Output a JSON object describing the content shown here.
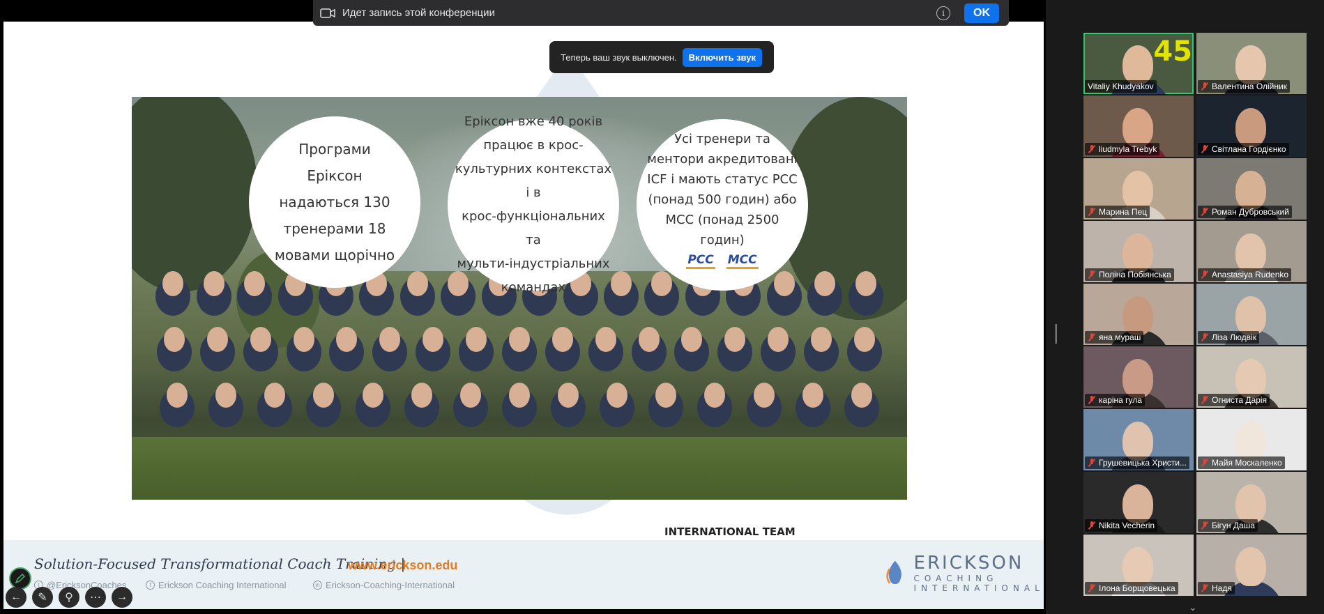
{
  "recording_banner": {
    "text": "Идет запись этой конференции",
    "ok_label": "OK"
  },
  "mute_toast": {
    "text": "Теперь ваш звук выключен.",
    "button_label": "Включить звук"
  },
  "slide": {
    "bubbles": [
      "Програми\nЕріксон\nнадаються 130\nтренерами 18\nмовами щорічно",
      "Еріксон вже 40 років\nпрацює в крос-\nкультурних контекстах і в\nкрос-функціональних та\nмульти-індустріальних\nкомандах",
      "Усі тренери та\nментори акредитовані\nICF і мають статус PCC\n(понад 500 годин) або\nMCC (понад 2500 годин)"
    ],
    "credential_logos": [
      "PCC",
      "MCC"
    ],
    "photo_caption": "INTERNATIONAL TEAM",
    "footer": {
      "title": "Solution-Focused Transformational Coach Training  |",
      "url": "www.erickson.edu",
      "twitter": "@EricksonCoaches",
      "facebook": "Erickson Coaching International",
      "linkedin": "Erickson-Coaching-International",
      "logo_line1": "ERICKSON",
      "logo_line2": "COACHING INTERNATIONAL"
    }
  },
  "participants": [
    {
      "name": "Vitaliy Khudyakov",
      "muted": false,
      "active": true
    },
    {
      "name": "Валентина Олійник",
      "muted": true
    },
    {
      "name": "liudmyla Trebyk",
      "muted": true
    },
    {
      "name": "Світлана Гордієнко",
      "muted": true
    },
    {
      "name": "Марина Пец",
      "muted": true
    },
    {
      "name": "Роман Дубровський",
      "muted": true
    },
    {
      "name": "Поліна Побіянська",
      "muted": true
    },
    {
      "name": "Anastasiya Rudenko",
      "muted": true
    },
    {
      "name": "яна мураш",
      "muted": true
    },
    {
      "name": "Ліза Людвік",
      "muted": true
    },
    {
      "name": "каріна гула",
      "muted": true
    },
    {
      "name": "Огниста Дарія",
      "muted": true
    },
    {
      "name": "Грушевицька Христи...",
      "muted": true
    },
    {
      "name": "Майя Москаленко",
      "muted": true
    },
    {
      "name": "Nikita Vecherin",
      "muted": true
    },
    {
      "name": "Бігун Даша",
      "muted": true
    },
    {
      "name": "Ілона Борщовецька",
      "muted": true
    },
    {
      "name": "Надя",
      "muted": true
    }
  ],
  "vitaliy_tile_overlay": "45"
}
